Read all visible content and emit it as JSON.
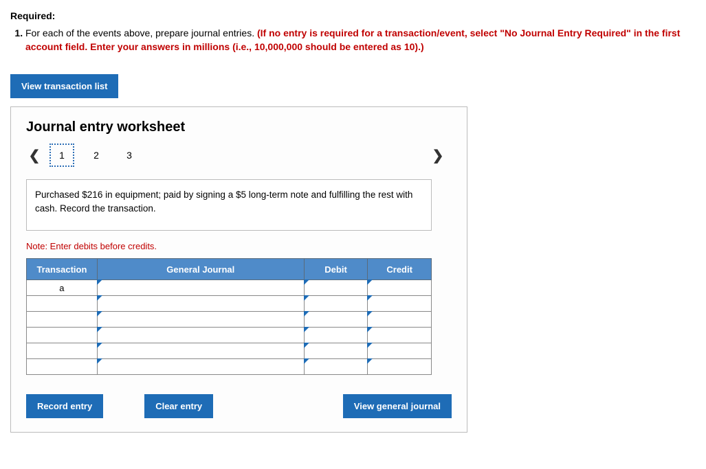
{
  "required_label": "Required:",
  "problem": {
    "prefix": "For each of the events above, prepare journal entries. ",
    "red_part": "(If no entry is required for a transaction/event, select \"No Journal Entry Required\" in the first account field. Enter your answers in millions (i.e., 10,000,000 should be entered as 10).)"
  },
  "view_list_btn": "View transaction list",
  "worksheet": {
    "title": "Journal entry worksheet",
    "pages": [
      "1",
      "2",
      "3"
    ],
    "selected_page_index": 0,
    "prompt": "Purchased $216 in equipment; paid by signing a $5 long-term note and fulfilling the rest with cash. Record the transaction.",
    "note": "Note: Enter debits before credits.",
    "headers": {
      "transaction": "Transaction",
      "general_journal": "General Journal",
      "debit": "Debit",
      "credit": "Credit"
    },
    "rows": [
      {
        "transaction": "a",
        "gj": "",
        "debit": "",
        "credit": ""
      },
      {
        "transaction": "",
        "gj": "",
        "debit": "",
        "credit": ""
      },
      {
        "transaction": "",
        "gj": "",
        "debit": "",
        "credit": ""
      },
      {
        "transaction": "",
        "gj": "",
        "debit": "",
        "credit": ""
      },
      {
        "transaction": "",
        "gj": "",
        "debit": "",
        "credit": ""
      },
      {
        "transaction": "",
        "gj": "",
        "debit": "",
        "credit": ""
      }
    ],
    "buttons": {
      "record": "Record entry",
      "clear": "Clear entry",
      "view_gj": "View general journal"
    }
  }
}
